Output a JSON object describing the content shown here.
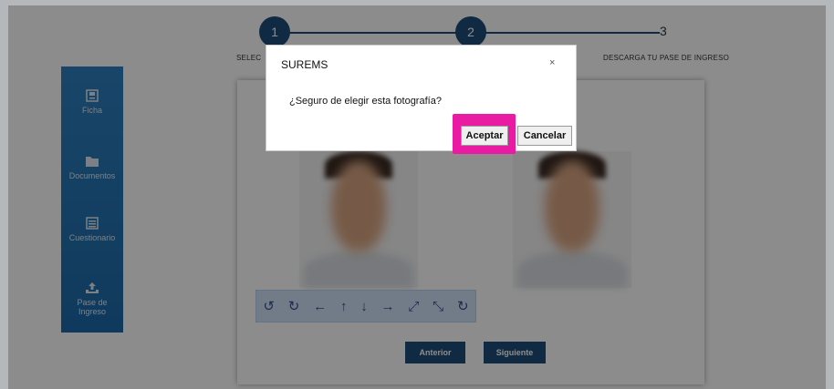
{
  "stepper": {
    "steps": [
      {
        "number": "1",
        "label": "SELEC"
      },
      {
        "number": "2",
        "label": ""
      },
      {
        "number": "3",
        "label": "DESCARGA TU PASE DE INGRESO"
      }
    ]
  },
  "sidebar": {
    "items": [
      {
        "label": "Ficha",
        "icon": "id-card-icon"
      },
      {
        "label": "Documentos",
        "icon": "folder-icon"
      },
      {
        "label": "Cuestionario",
        "icon": "form-icon"
      },
      {
        "label_line1": "Pase de",
        "label_line2": "Ingreso",
        "icon": "upload-tray-icon"
      }
    ]
  },
  "toolbar": {
    "tools": [
      "↺",
      "↻",
      "←",
      "↑",
      "↓",
      "→",
      "⤢",
      "⤡",
      "↻"
    ]
  },
  "nav": {
    "previous_label": "Anterior",
    "next_label": "Siguiente"
  },
  "modal": {
    "title": "SUREMS",
    "close_label": "×",
    "message": "¿Seguro de elegir esta fotografía?",
    "accept_label": "Aceptar",
    "cancel_label": "Cancelar"
  },
  "colors": {
    "primary": "#1d4e79",
    "sidebar": "#2d7fbf",
    "highlight": "#e81ba2"
  }
}
